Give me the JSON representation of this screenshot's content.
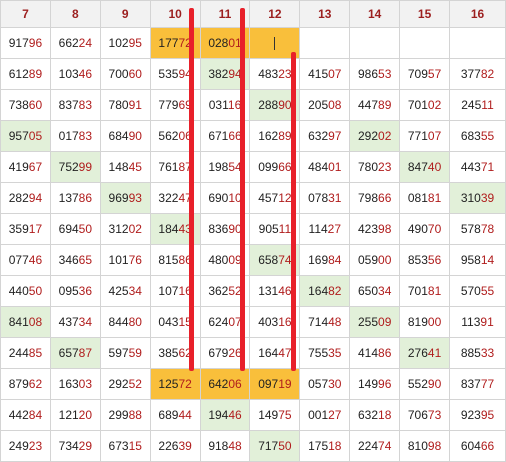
{
  "headers": [
    "7",
    "8",
    "9",
    "10",
    "11",
    "12",
    "13",
    "14",
    "15",
    "16"
  ],
  "rows": [
    [
      "91796",
      "66224",
      "10295",
      "17772",
      "02801",
      "",
      "",
      "",
      "",
      ""
    ],
    [
      "61289",
      "10346",
      "70060",
      "53594",
      "38294",
      "48323",
      "41507",
      "98653",
      "70957",
      "37782"
    ],
    [
      "73860",
      "83783",
      "78091",
      "77969",
      "03116",
      "28890",
      "20508",
      "44789",
      "70102",
      "24511"
    ],
    [
      "95705",
      "01783",
      "68490",
      "56206",
      "67166",
      "16289",
      "63297",
      "29202",
      "77107",
      "68355"
    ],
    [
      "41967",
      "75299",
      "14845",
      "76187",
      "19854",
      "09966",
      "48401",
      "78023",
      "84740",
      "44371"
    ],
    [
      "28294",
      "13786",
      "96993",
      "32247",
      "69010",
      "45712",
      "07831",
      "79866",
      "08181",
      "31039"
    ],
    [
      "35917",
      "69450",
      "31202",
      "18443",
      "83690",
      "90511",
      "11427",
      "42398",
      "49070",
      "57878"
    ],
    [
      "07746",
      "34665",
      "10176",
      "81586",
      "48009",
      "65874",
      "16984",
      "05900",
      "85356",
      "95814"
    ],
    [
      "44050",
      "09536",
      "42534",
      "10716",
      "36252",
      "13146",
      "16482",
      "65034",
      "70181",
      "57055"
    ],
    [
      "84108",
      "43734",
      "84480",
      "04315",
      "62407",
      "40316",
      "71448",
      "25509",
      "81900",
      "11391"
    ],
    [
      "24485",
      "65787",
      "59759",
      "38562",
      "67926",
      "16447",
      "75535",
      "41486",
      "27641",
      "88533"
    ],
    [
      "87962",
      "16303",
      "29252",
      "12572",
      "64206",
      "09719",
      "05730",
      "14996",
      "55290",
      "83777"
    ],
    [
      "44284",
      "12120",
      "29988",
      "68944",
      "19446",
      "14975",
      "00127",
      "63218",
      "70673",
      "92395"
    ],
    [
      "24923",
      "73429",
      "67315",
      "22639",
      "91848",
      "71750",
      "17518",
      "22474",
      "81098",
      "60466"
    ]
  ],
  "highlight": {
    "green": [
      [
        1,
        4
      ],
      [
        2,
        5
      ],
      [
        3,
        0
      ],
      [
        3,
        7
      ],
      [
        4,
        1
      ],
      [
        4,
        8
      ],
      [
        5,
        2
      ],
      [
        5,
        9
      ],
      [
        6,
        3
      ],
      [
        7,
        5
      ],
      [
        8,
        6
      ],
      [
        9,
        0
      ],
      [
        9,
        7
      ],
      [
        10,
        1
      ],
      [
        10,
        8
      ],
      [
        12,
        4
      ],
      [
        13,
        5
      ]
    ],
    "orange": [
      [
        0,
        3
      ],
      [
        0,
        4
      ],
      [
        0,
        5
      ],
      [
        11,
        3
      ],
      [
        11,
        4
      ],
      [
        11,
        5
      ]
    ]
  },
  "editing_cell": [
    0,
    5
  ],
  "colors": {
    "green": "#e2f0d9",
    "orange": "#f9bf3b",
    "header_text": "#9c1f1f",
    "digit_accent": "#b01c1c",
    "marker": "#e8202a"
  }
}
